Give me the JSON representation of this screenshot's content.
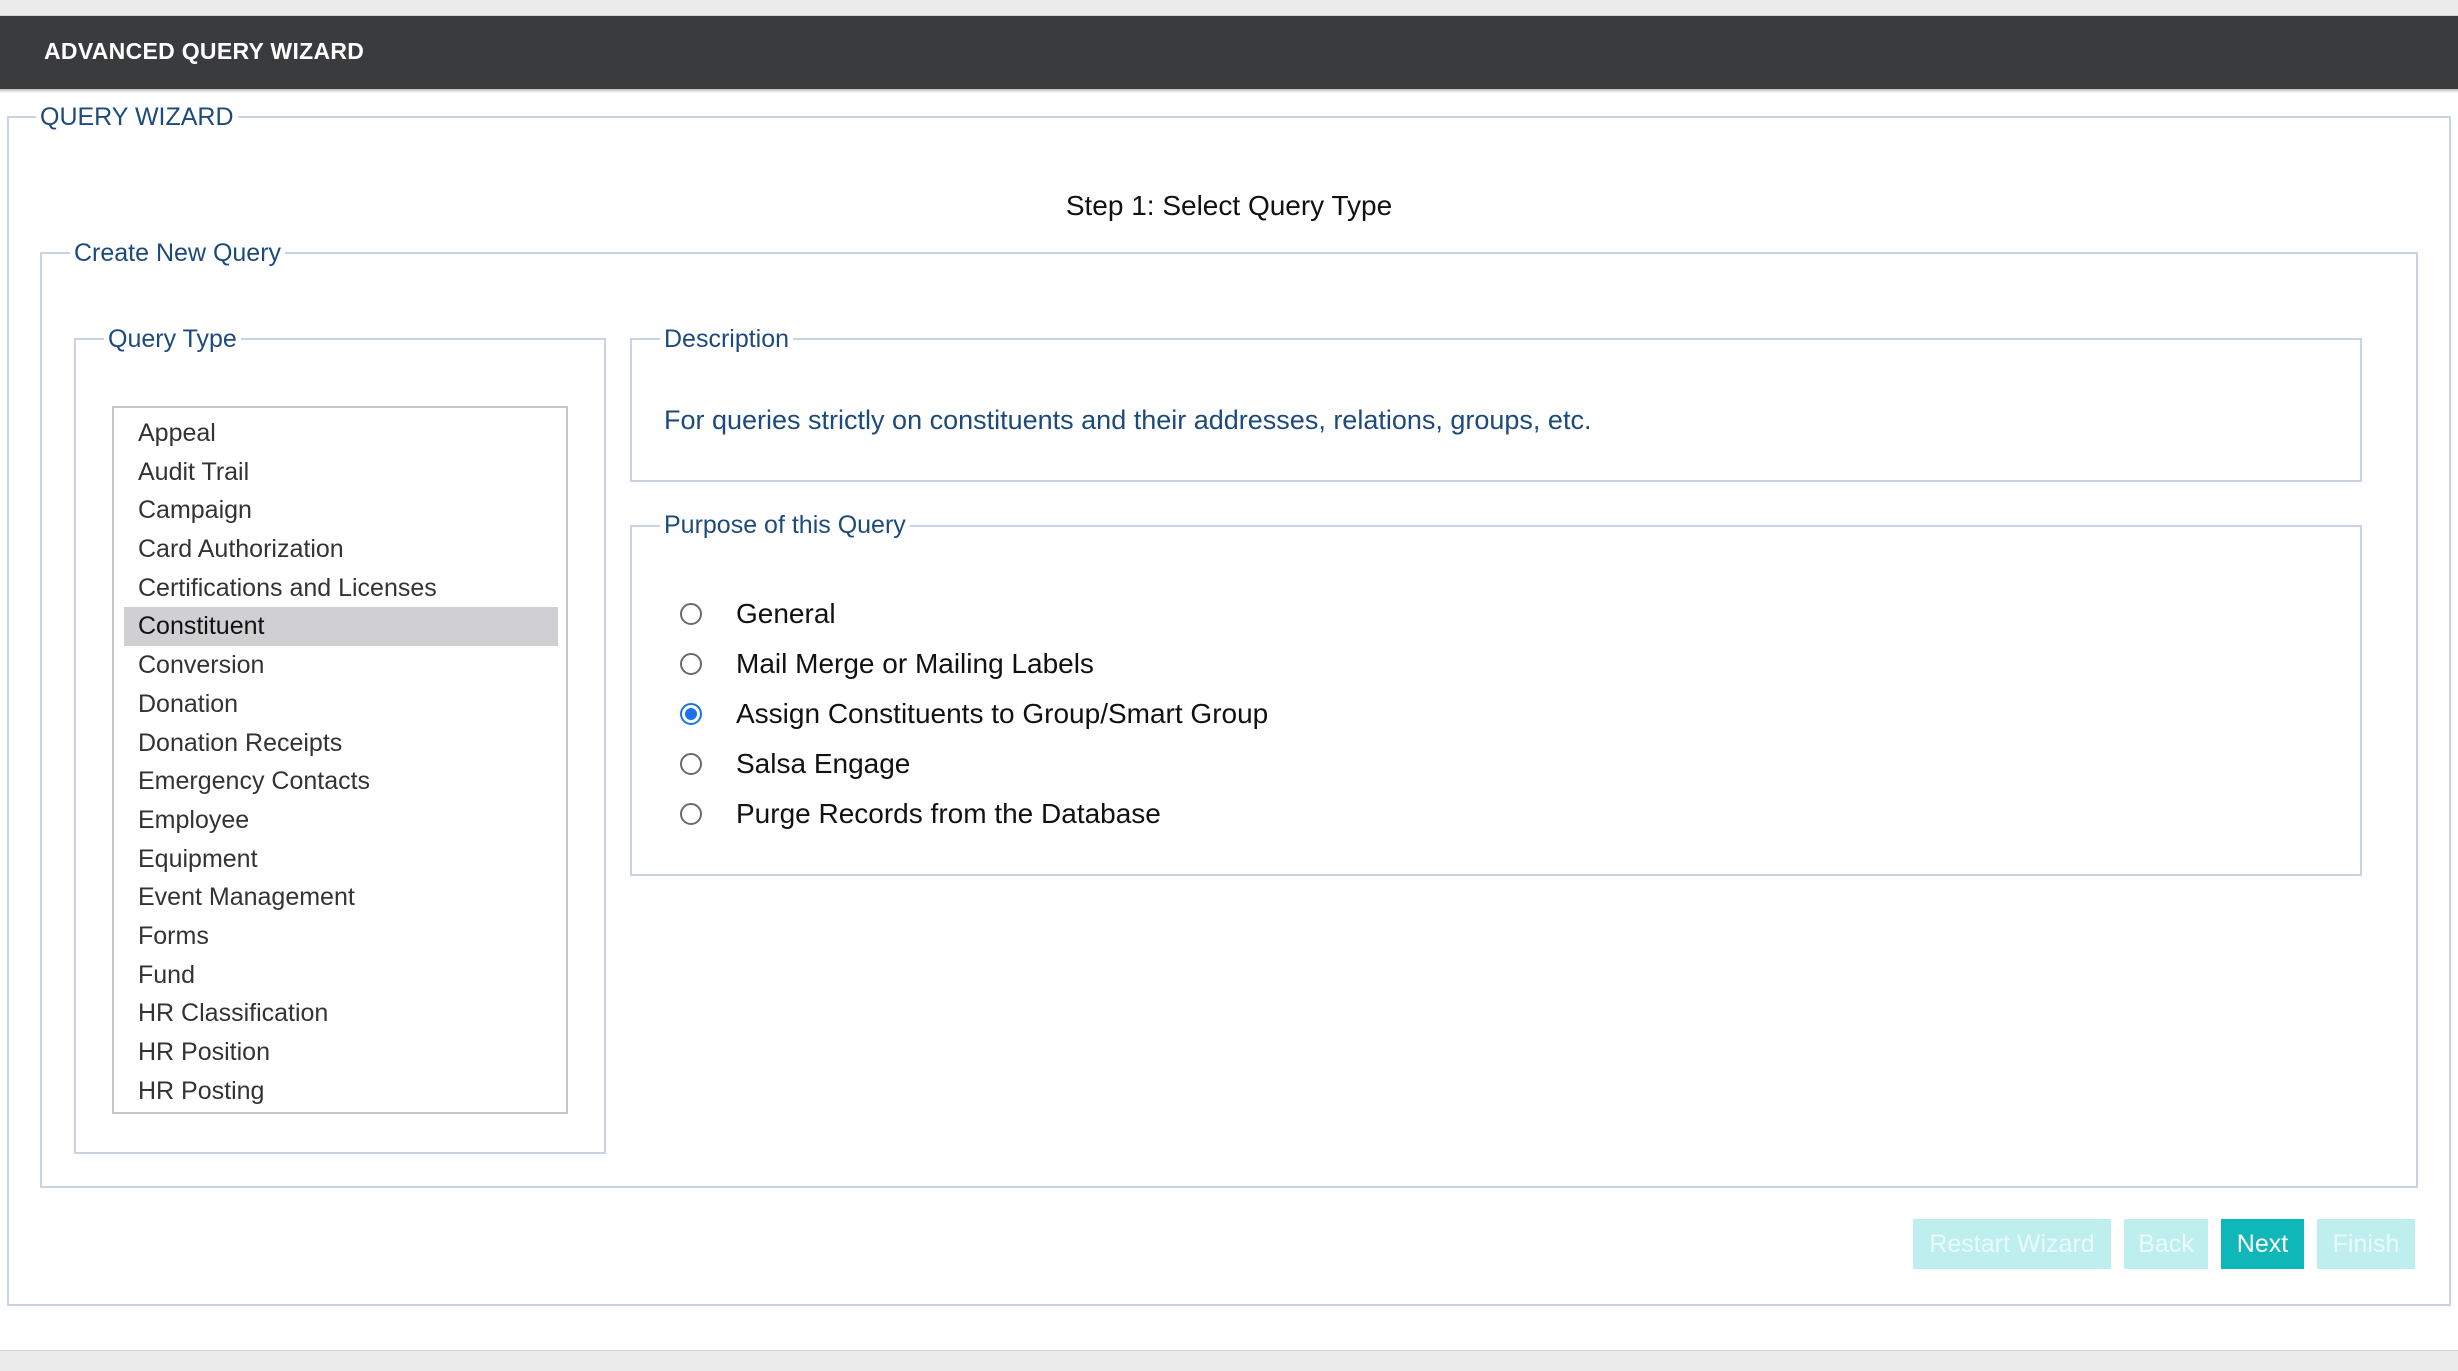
{
  "window": {
    "title": "ADVANCED QUERY WIZARD"
  },
  "wizard": {
    "legend": "QUERY WIZARD",
    "step_title": "Step 1: Select Query Type"
  },
  "create_new": {
    "legend": "Create New Query"
  },
  "query_type": {
    "legend": "Query Type",
    "items": [
      "Appeal",
      "Audit Trail",
      "Campaign",
      "Card Authorization",
      "Certifications and Licenses",
      "Constituent",
      "Conversion",
      "Donation",
      "Donation Receipts",
      "Emergency Contacts",
      "Employee",
      "Equipment",
      "Event Management",
      "Forms",
      "Fund",
      "HR Classification",
      "HR Position",
      "HR Posting"
    ],
    "selected": "Constituent"
  },
  "description": {
    "legend": "Description",
    "text": "For queries strictly on constituents and their addresses, relations, groups, etc."
  },
  "purpose": {
    "legend": "Purpose of this Query",
    "options": [
      {
        "label": "General",
        "checked": false
      },
      {
        "label": "Mail Merge or Mailing Labels",
        "checked": false
      },
      {
        "label": "Assign Constituents to Group/Smart Group",
        "checked": true
      },
      {
        "label": "Salsa Engage",
        "checked": false
      },
      {
        "label": "Purge Records from the Database",
        "checked": false
      }
    ]
  },
  "buttons": {
    "restart": "Restart Wizard",
    "back": "Back",
    "next": "Next",
    "finish": "Finish"
  },
  "colors": {
    "titlebar": "#3a3b3d",
    "accent": "#10b7b8",
    "accent_disabled": "#bfeeee",
    "legend_text": "#1d4a7c",
    "radio_checked": "#1a73e8",
    "selected_row": "#d0d0d2"
  }
}
